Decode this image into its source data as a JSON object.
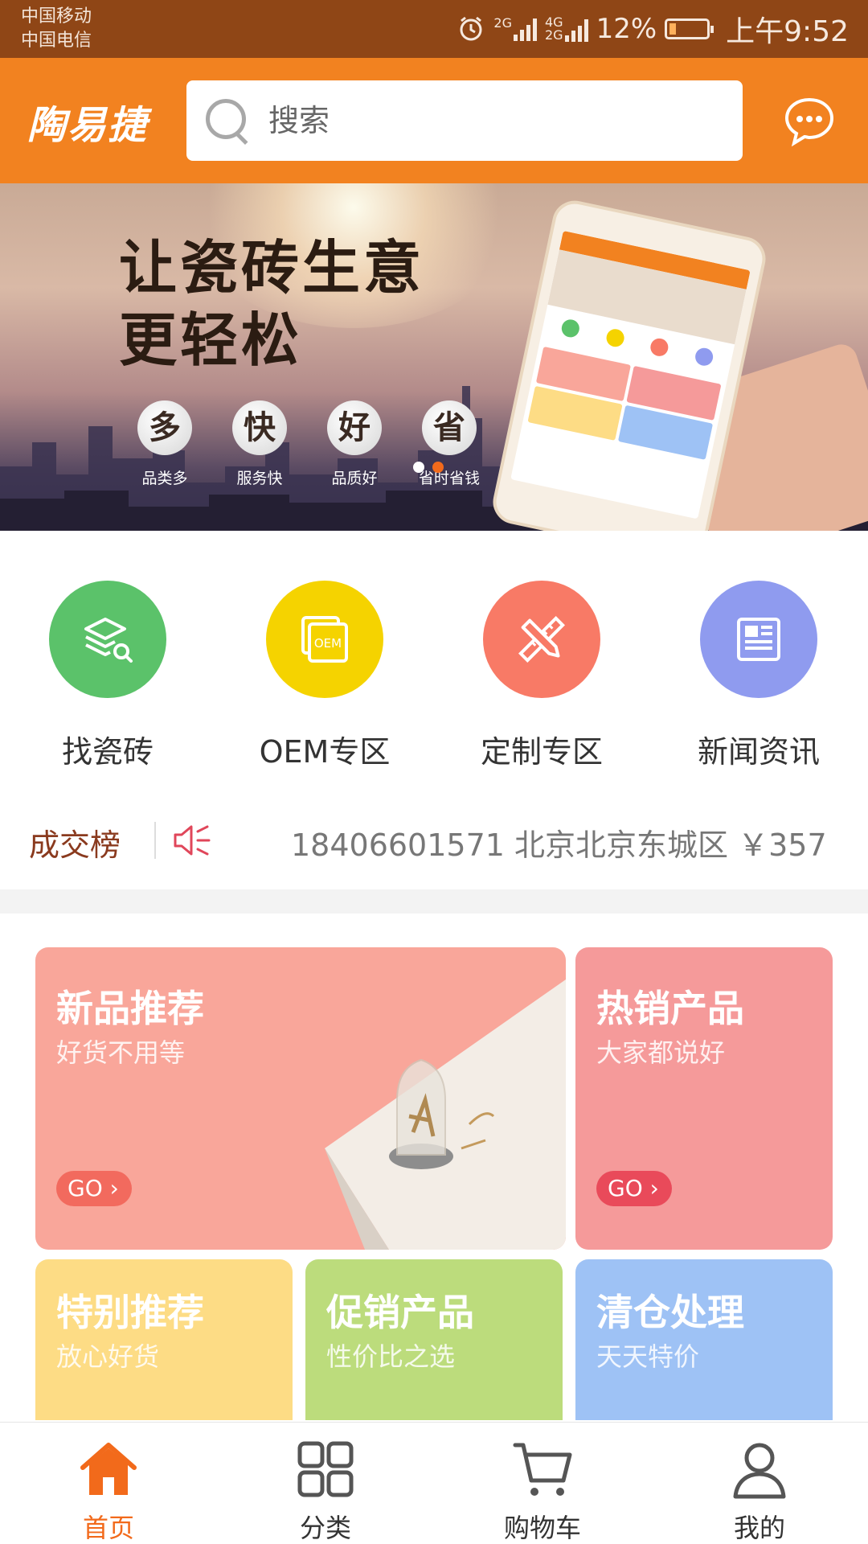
{
  "status_bar": {
    "carrier_1": "中国移动",
    "carrier_2": "中国电信",
    "signal_1_label": "2G",
    "signal_2_label_top": "4G",
    "signal_2_label_bottom": "2G",
    "battery": "12%",
    "time": "上午9:52"
  },
  "header": {
    "logo": "陶易捷",
    "search_placeholder": "搜索"
  },
  "banner": {
    "title_line1": "让瓷砖生意",
    "title_line2": "更轻松",
    "tags": [
      {
        "char": "多",
        "label": "品类多"
      },
      {
        "char": "快",
        "label": "服务快"
      },
      {
        "char": "好",
        "label": "品质好"
      },
      {
        "char": "省",
        "label": "省时省钱"
      }
    ],
    "carousel_active_index": 2,
    "carousel_count": 2
  },
  "quick_links": [
    {
      "label": "找瓷砖",
      "color": "#5bc26a",
      "icon": "layers-search-icon"
    },
    {
      "label": "OEM专区",
      "color": "#f5d300",
      "icon": "oem-icon",
      "icon_text": "OEM"
    },
    {
      "label": "定制专区",
      "color": "#f87a66",
      "icon": "ruler-pencil-icon"
    },
    {
      "label": "新闻资讯",
      "color": "#8f9bef",
      "icon": "newspaper-icon"
    }
  ],
  "ticker": {
    "title": "成交榜",
    "text": "18406601571 北京北京东城区 ￥357"
  },
  "cards": {
    "new": {
      "title": "新品推荐",
      "subtitle": "好货不用等",
      "go": "GO",
      "color": "#f9a69a"
    },
    "hot": {
      "title": "热销产品",
      "subtitle": "大家都说好",
      "go": "GO",
      "color": "#f59a9a"
    },
    "special": {
      "title": "特别推荐",
      "subtitle": "放心好货",
      "color": "#fddc85"
    },
    "promo": {
      "title": "促销产品",
      "subtitle": "性价比之选",
      "color": "#bcdc7c"
    },
    "clear": {
      "title": "清仓处理",
      "subtitle": "天天特价",
      "color": "#9ec2f5"
    }
  },
  "nav": {
    "items": [
      {
        "label": "首页",
        "icon": "home-icon",
        "active": true
      },
      {
        "label": "分类",
        "icon": "grid-icon",
        "active": false
      },
      {
        "label": "购物车",
        "icon": "cart-icon",
        "active": false
      },
      {
        "label": "我的",
        "icon": "user-icon",
        "active": false
      }
    ],
    "active_color": "#f26a1b"
  }
}
